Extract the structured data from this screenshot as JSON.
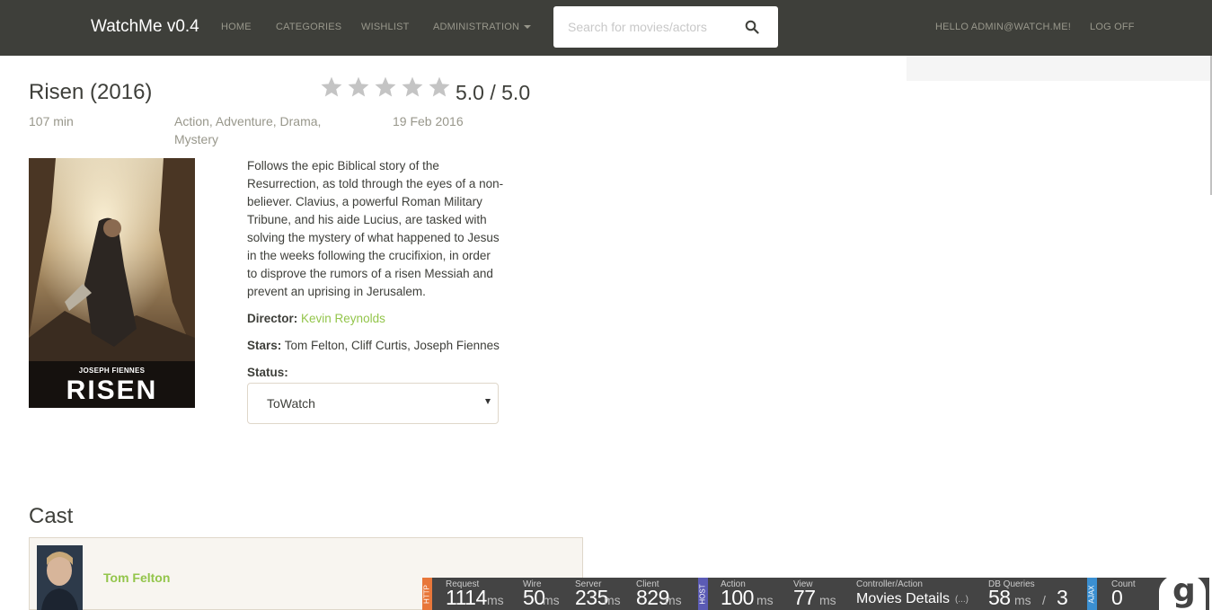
{
  "navbar": {
    "brand": "WatchMe v0.4",
    "links": [
      "HOME",
      "CATEGORIES",
      "WISHLIST",
      "ADMINISTRATION"
    ],
    "search_placeholder": "Search for movies/actors",
    "user_greeting": "HELLO ADMIN@WATCH.ME!",
    "logoff": "LOG OFF",
    "icons": {
      "search": "search-icon",
      "dropdown": "caret-down-icon"
    }
  },
  "movie": {
    "title": "Risen (2016)",
    "rating_text": "5.0 / 5.0",
    "stars_count": 5,
    "duration": "107 min",
    "genres_line1": "Action, Adventure, Drama,",
    "genres_line2": "Mystery",
    "release_date": "19 Feb 2016",
    "poster_actor": "JOSEPH FIENNES",
    "poster_title": "RISEN",
    "plot_lines": [
      "Follows the epic Biblical story of the",
      "Resurrection, as told through the eyes of a non-",
      "believer. Clavius, a powerful Roman Military",
      "Tribune, and his aide Lucius, are tasked with",
      "solving the mystery of what happened to Jesus",
      "in the weeks following the crucifixion, in order",
      "to disprove the rumors of a risen Messiah and",
      "prevent an uprising in Jerusalem."
    ],
    "director_label": "Director:",
    "director": "Kevin Reynolds",
    "stars_label": "Stars:",
    "stars": "Tom Felton, Cliff Curtis, Joseph Fiennes",
    "status_label": "Status:",
    "status_value": "ToWatch"
  },
  "cast": {
    "heading": "Cast",
    "members": [
      {
        "name": "Tom Felton"
      }
    ]
  },
  "glimpse": {
    "tabs": [
      "HTTP",
      "HOST",
      "AJAX"
    ],
    "request_label": "Request",
    "request_value": "1114",
    "request_unit": "ms",
    "wire_label": "Wire",
    "wire_value": "50",
    "wire_unit": "ms",
    "server_label": "Server",
    "server_value": "235",
    "server_unit": "ms",
    "client_label": "Client",
    "client_value": "829",
    "client_unit": "ms",
    "action_label": "Action",
    "action_value": "100",
    "action_unit": "ms",
    "view_label": "View",
    "view_value": "77",
    "view_unit": "ms",
    "controller_label": "Controller/Action",
    "controller_value": "Movies Details",
    "controller_suffix": "(...)",
    "db_label": "DB Queries",
    "db_value": "58",
    "db_unit": "ms",
    "db_sep": "/",
    "db_count": "3",
    "count_label": "Count",
    "count_value": "0",
    "logo": "g"
  },
  "colors": {
    "navbar": "#3e3f3a",
    "accent_green": "#93c54b",
    "muted_text": "#98978b",
    "http_tab": "#e8773a",
    "host_tab": "#5b5bb5",
    "ajax_tab": "#3b8fd1",
    "star_gray": "#c4c4c4"
  }
}
